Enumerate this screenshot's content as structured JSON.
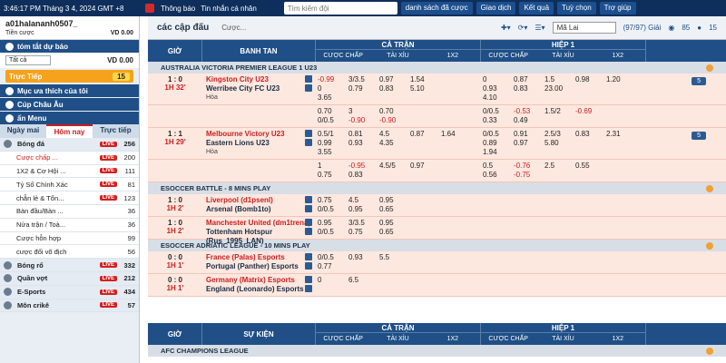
{
  "topbar": {
    "datetime": "3:46:17 PM Tháng 3 4, 2024 GMT +8",
    "notif_label": "Thông báo",
    "msg_label": "Tin nhắn cá nhân",
    "search_placeholder": "Tìm kiếm đội",
    "buttons": [
      "danh sách đã cược",
      "Giao dịch",
      "Kết quả",
      "Tuỳ chọn",
      "Trợ giúp"
    ]
  },
  "account": {
    "username": "a01halananh0507_",
    "credit_label": "Tiền cược",
    "credit_value": "VD 0.00"
  },
  "sidebar": {
    "summary_title": "tóm tắt dự báo",
    "select_value": "Tất cả",
    "summary_value": "VD 0.00",
    "live_label": "Trực Tiếp",
    "live_count": "15",
    "favorites_title": "Mục ưa thích của tôi",
    "euro_title": "Cúp Châu Âu",
    "menu_title": "ẩn Menu",
    "tabs": [
      "Ngày mai",
      "Hôm nay",
      "Trực tiếp"
    ],
    "sports": [
      {
        "name": "Bóng đá",
        "live": "LIVE",
        "count": "256",
        "main": true
      },
      {
        "name": "Cược chấp ...",
        "live": "LIVE",
        "count": "200",
        "main": false,
        "red": true
      },
      {
        "name": "1X2 & Cơ Hội ...",
        "live": "LIVE",
        "count": "111",
        "main": false
      },
      {
        "name": "Tỷ Số Chính Xác",
        "live": "LIVE",
        "count": "81",
        "main": false
      },
      {
        "name": "chẵn lẻ & Tổn...",
        "live": "LIVE",
        "count": "123",
        "main": false
      },
      {
        "name": "Bàn đầu/Bàn ...",
        "live": "",
        "count": "36",
        "main": false
      },
      {
        "name": "Nửa trận / Toà...",
        "live": "",
        "count": "36",
        "main": false
      },
      {
        "name": "Cược hỗn hợp",
        "live": "",
        "count": "99",
        "main": false
      },
      {
        "name": "cược đối võ địch",
        "live": "",
        "count": "56",
        "main": false
      },
      {
        "name": "Bóng rổ",
        "live": "LIVE",
        "count": "332",
        "main": true
      },
      {
        "name": "Quần vợt",
        "live": "LIVE",
        "count": "212",
        "main": true
      },
      {
        "name": "E-Sports",
        "live": "LIVE",
        "count": "434",
        "main": true
      },
      {
        "name": "Môn crikê",
        "live": "LIVE",
        "count": "57",
        "main": true
      }
    ]
  },
  "main": {
    "title": "các cập đấu",
    "sub": "Cược...",
    "market": "Mã Lai",
    "count": "(97/97) Giải",
    "icons_counts": [
      "85",
      "15"
    ],
    "headers": {
      "time": "GIỜ",
      "teams": "BANH TAN",
      "full": "CẢ TRẬN",
      "half": "HIỆP 1",
      "sub": [
        "CƯỢC CHẤP",
        "TÀI XỈU",
        "1X2"
      ],
      "events": "SỰ KIỆN"
    },
    "more_label": "5",
    "leagues": [
      {
        "name": "AUSTRALIA VICTORIA PREMIER LEAGUE 1 U23",
        "matches": [
          {
            "score": "1 : 0",
            "time": "1H 32'",
            "home": "Kingston City U23",
            "away": "Werribee City FC U23",
            "draw": "Hòa",
            "full": [
              "-0.99 3/3.5 0.97 1.54",
              "0 0.79 0.83 5.10",
              "3.65"
            ],
            "half": [
              "0 0.87 1.5 0.98 1.20",
              "0.93 0.83 23.00",
              "4.10"
            ]
          },
          {
            "score": "",
            "time": "",
            "home": "",
            "away": "",
            "draw": "",
            "full": [
              "0.70 3 0.70",
              "0/0.5 -0.90 -0.90"
            ],
            "half": [
              "0/0.5 -0.53 1.5/2 -0.69",
              "0.33 0.49"
            ]
          },
          {
            "score": "1 : 1",
            "time": "1H 29'",
            "home": "Melbourne Victory U23",
            "away": "Eastern Lions U23",
            "draw": "Hòa",
            "full": [
              "0.5/1 0.81 4.5 0.87 1.64",
              "0.99 0.93 4.35",
              "3.55"
            ],
            "half": [
              "0/0.5 0.91 2.5/3 0.83 2.31",
              "0.89 0.97 5.80",
              "1.94"
            ]
          },
          {
            "score": "",
            "time": "",
            "home": "",
            "away": "",
            "draw": "",
            "full": [
              "1 -0.95 4.5/5 0.97",
              "0.75 0.83"
            ],
            "half": [
              "0.5 -0.76 2.5 0.55",
              "0.56 -0.75"
            ]
          }
        ]
      },
      {
        "name": "ESOCCER BATTLE - 8 MINS PLAY",
        "matches": [
          {
            "score": "1 : 0",
            "time": "1H 2'",
            "home": "Liverpool (d1psenl)",
            "away": "Arsenal (Bomb1to)",
            "draw": "",
            "full": [
              "0.75 4.5 0.95",
              "0/0.5 0.95 0.65"
            ],
            "half": []
          },
          {
            "score": "1 : 0",
            "time": "1H 2'",
            "home": "Manchester United (dm1trena)",
            "away": "Tottenham Hotspur (Rus_1995_LAN)",
            "draw": "",
            "full": [
              "0.95 3/3.5 0.95",
              "0/0.5 0.75 0.65"
            ],
            "half": []
          }
        ]
      },
      {
        "name": "ESOCCER ADRIATIC LEAGUE - 10 MINS PLAY",
        "matches": [
          {
            "score": "0 : 0",
            "time": "1H 1'",
            "home": "France (Palas) Esports",
            "away": "Portugal (Panther) Esports",
            "draw": "",
            "full": [
              "0/0.5 0.93 5.5",
              "0.77"
            ],
            "half": []
          },
          {
            "score": "0 : 0",
            "time": "1H 1'",
            "home": "Germany (Matrix) Esports",
            "away": "England (Leonardo) Esports",
            "draw": "",
            "full": [
              "0 6.5"
            ],
            "half": []
          }
        ]
      }
    ],
    "footer_league": "AFC CHAMPIONS LEAGUE"
  }
}
